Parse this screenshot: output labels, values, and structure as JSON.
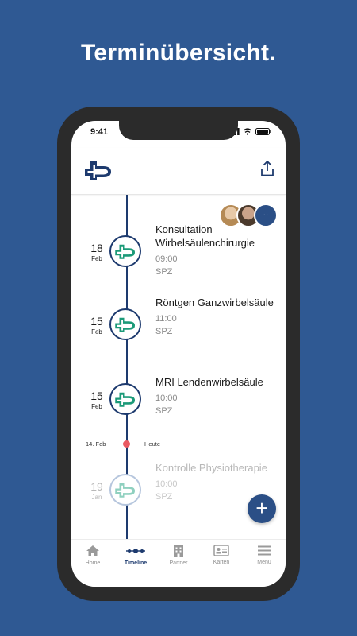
{
  "headline": "Terminübersicht.",
  "status": {
    "time": "9:41"
  },
  "appbar": {
    "logo": "cross-logo-icon",
    "share": "share-icon"
  },
  "appointments": [
    {
      "day": "18",
      "month": "Feb",
      "title": "Konsultation Wirbelsäulenchirurgie",
      "time": "09:00",
      "place": "SPZ",
      "faded": false
    },
    {
      "day": "15",
      "month": "Feb",
      "title": "Röntgen Ganzwirbelsäule",
      "time": "11:00",
      "place": "SPZ",
      "faded": false
    },
    {
      "day": "15",
      "month": "Feb",
      "title": "MRI Lendenwirbelsäule",
      "time": "10:00",
      "place": "SPZ",
      "faded": false
    },
    {
      "day": "19",
      "month": "Jan",
      "title": "Kontrolle Physiotherapie",
      "time": "10:00",
      "place": "SPZ",
      "faded": true
    }
  ],
  "today": {
    "date": "14. Feb",
    "label": "Heute"
  },
  "fab": {
    "label": "+"
  },
  "tabs": [
    {
      "label": "Home",
      "icon": "home-icon",
      "active": false
    },
    {
      "label": "Timeline",
      "icon": "timeline-icon",
      "active": true
    },
    {
      "label": "Partner",
      "icon": "building-icon",
      "active": false
    },
    {
      "label": "Karten",
      "icon": "card-icon",
      "active": false
    },
    {
      "label": "Menü",
      "icon": "menu-icon",
      "active": false
    }
  ],
  "colors": {
    "brand": "#1d3a6e",
    "accent": "#1b9a78",
    "background": "#2f5993",
    "today_dot": "#ea5a62"
  }
}
